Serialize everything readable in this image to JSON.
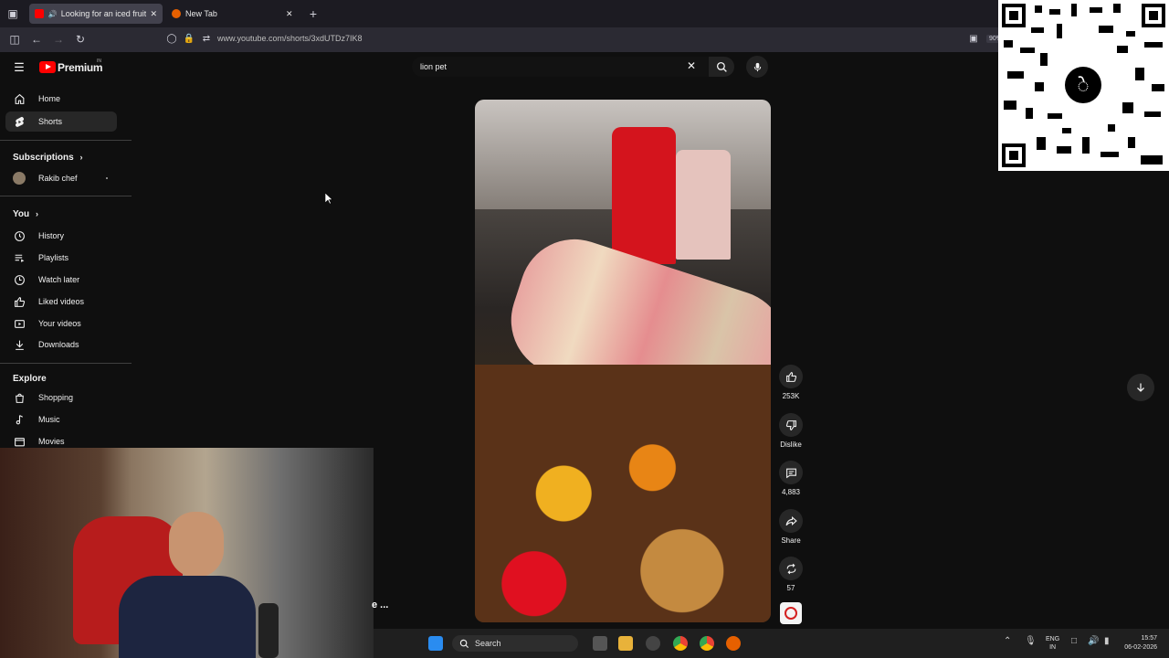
{
  "browser": {
    "tabs": [
      {
        "label": "Looking for an iced fruit sal",
        "active": true
      },
      {
        "label": "New Tab",
        "active": false
      }
    ],
    "url": "www.youtube.com/shorts/3xdUTDz7IK8",
    "zoom": "90%"
  },
  "youtube": {
    "logo": "Premium",
    "region": "IN",
    "search_value": "lion pet",
    "sidebar": {
      "main": [
        {
          "label": "Home",
          "icon": "home-icon"
        },
        {
          "label": "Shorts",
          "icon": "shorts-icon"
        }
      ],
      "subscriptions_title": "Subscriptions",
      "subscriptions": [
        {
          "label": "Rakib chef"
        }
      ],
      "you_title": "You",
      "you": [
        {
          "label": "History",
          "icon": "history-icon"
        },
        {
          "label": "Playlists",
          "icon": "playlists-icon"
        },
        {
          "label": "Watch later",
          "icon": "watch-later-icon"
        },
        {
          "label": "Liked videos",
          "icon": "liked-icon"
        },
        {
          "label": "Your videos",
          "icon": "your-videos-icon"
        },
        {
          "label": "Downloads",
          "icon": "download-icon"
        }
      ],
      "explore_title": "Explore",
      "explore": [
        {
          "label": "Shopping",
          "icon": "shopping-icon"
        },
        {
          "label": "Music",
          "icon": "music-icon"
        },
        {
          "label": "Movies",
          "icon": "movies-icon"
        }
      ]
    },
    "actions": {
      "likes": "253K",
      "dislike": "Dislike",
      "comments": "4,883",
      "share": "Share",
      "remix": "57"
    }
  },
  "overlay_text": "e ...",
  "taskbar": {
    "search": "Search",
    "lang_top": "ENG",
    "lang_bottom": "IN",
    "time": "15:57",
    "date": "06-02-2026"
  },
  "colors": {
    "yt_red": "#ff0000",
    "bg": "#0f0f0f",
    "sidebar_active": "#272727"
  }
}
